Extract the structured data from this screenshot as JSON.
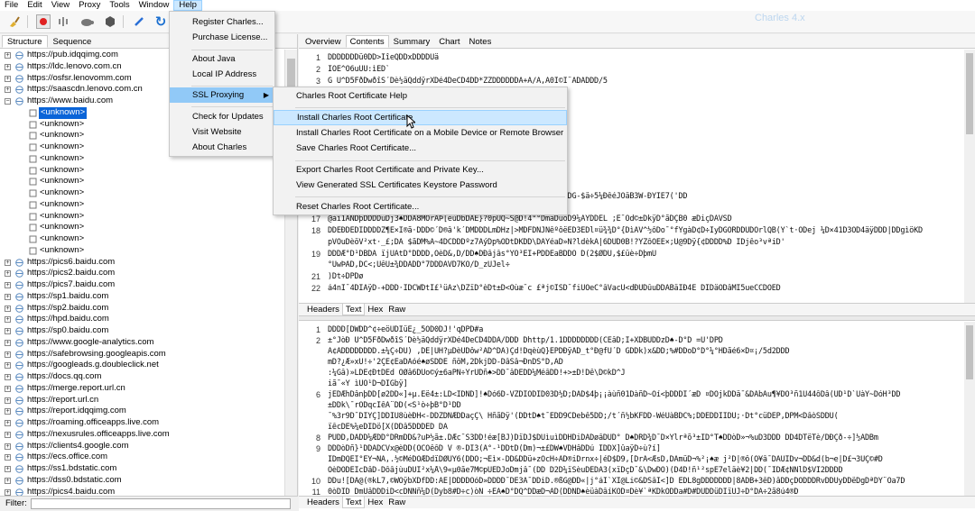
{
  "menubar": [
    "File",
    "Edit",
    "View",
    "Proxy",
    "Tools",
    "Window",
    "Help"
  ],
  "title_faint": "Charles 4.x",
  "toolbar": [
    {
      "name": "broom-icon",
      "glyph": "🧹",
      "color": "#d4a020"
    },
    {
      "name": "record-icon",
      "glyph": "●",
      "color": "#e02020"
    },
    {
      "name": "throttle-icon",
      "glyph": "⋮",
      "color": "#888"
    },
    {
      "name": "turtle-icon",
      "glyph": "🐢",
      "color": "#666"
    },
    {
      "name": "breakpoint-icon",
      "glyph": "⬢",
      "color": "#555"
    },
    {
      "name": "pen-icon",
      "glyph": "✎",
      "color": "#2a6fd6"
    },
    {
      "name": "refresh-icon",
      "glyph": "↻",
      "color": "#1a6fd0"
    }
  ],
  "left_tabs": [
    "Structure",
    "Sequence"
  ],
  "tree": [
    {
      "label": "https://pub.idqqimg.com",
      "child": false,
      "exp": "+"
    },
    {
      "label": "https://ldc.lenovo.com.cn",
      "child": false,
      "exp": "+"
    },
    {
      "label": "https://osfsr.lenovomm.com",
      "child": false,
      "exp": "+"
    },
    {
      "label": "https://saascdn.lenovo.com.cn",
      "child": false,
      "exp": "+"
    },
    {
      "label": "https://www.baidu.com",
      "child": false,
      "exp": "−"
    },
    {
      "label": "<unknown>",
      "child": true,
      "sel": true
    },
    {
      "label": "<unknown>",
      "child": true
    },
    {
      "label": "<unknown>",
      "child": true
    },
    {
      "label": "<unknown>",
      "child": true
    },
    {
      "label": "<unknown>",
      "child": true
    },
    {
      "label": "<unknown>",
      "child": true
    },
    {
      "label": "<unknown>",
      "child": true
    },
    {
      "label": "<unknown>",
      "child": true
    },
    {
      "label": "<unknown>",
      "child": true
    },
    {
      "label": "<unknown>",
      "child": true
    },
    {
      "label": "<unknown>",
      "child": true
    },
    {
      "label": "<unknown>",
      "child": true
    },
    {
      "label": "<unknown>",
      "child": true
    },
    {
      "label": "https://pics6.baidu.com",
      "child": false,
      "exp": "+"
    },
    {
      "label": "https://pics2.baidu.com",
      "child": false,
      "exp": "+"
    },
    {
      "label": "https://pics7.baidu.com",
      "child": false,
      "exp": "+"
    },
    {
      "label": "https://sp1.baidu.com",
      "child": false,
      "exp": "+"
    },
    {
      "label": "https://sp2.baidu.com",
      "child": false,
      "exp": "+"
    },
    {
      "label": "https://hpd.baidu.com",
      "child": false,
      "exp": "+"
    },
    {
      "label": "https://sp0.baidu.com",
      "child": false,
      "exp": "+"
    },
    {
      "label": "https://www.google-analytics.com",
      "child": false,
      "exp": "+"
    },
    {
      "label": "https://safebrowsing.googleapis.com",
      "child": false,
      "exp": "+"
    },
    {
      "label": "https://googleads.g.doubleclick.net",
      "child": false,
      "exp": "+"
    },
    {
      "label": "https://docs.qq.com",
      "child": false,
      "exp": "+"
    },
    {
      "label": "https://merge.report.url.cn",
      "child": false,
      "exp": "+"
    },
    {
      "label": "https://report.url.cn",
      "child": false,
      "exp": "+"
    },
    {
      "label": "https://report.idqqimg.com",
      "child": false,
      "exp": "+"
    },
    {
      "label": "https://roaming.officeapps.live.com",
      "child": false,
      "exp": "+"
    },
    {
      "label": "https://nexusrules.officeapps.live.com",
      "child": false,
      "exp": "+"
    },
    {
      "label": "https://clients4.google.com",
      "child": false,
      "exp": "+"
    },
    {
      "label": "https://ecs.office.com",
      "child": false,
      "exp": "+"
    },
    {
      "label": "https://ss1.bdstatic.com",
      "child": false,
      "exp": "+"
    },
    {
      "label": "https://dss0.bdstatic.com",
      "child": false,
      "exp": "+"
    },
    {
      "label": "https://pics4.baidu.com",
      "child": false,
      "exp": "+"
    }
  ],
  "filter_label": "Filter:",
  "right_tabs": [
    "Overview",
    "Contents",
    "Summary",
    "Chart",
    "Notes"
  ],
  "upper_lines": [
    {
      "n": "1",
      "t": "DDDDDDDü0DD>ÎîeQDDxDDDDÜä"
    },
    {
      "n": "2",
      "t": "ÎÔÊ^Ò6uÜÜ:ìÈD`"
    },
    {
      "n": "3",
      "t": "                G Ù^D5FðDwðîS´Dè½äQddÿrXDé4DeCD4DD*ZZDDDDDDÀ+À/À,À0Ì©Ì¨ÀDÀDDD/5"
    },
    {
      "n": "",
      "t": ""
    },
    {
      "n": "",
      "t": ""
    },
    {
      "n": "",
      "t": "                                                                          WrÚ1ì:RçâÃD4DázÆP¼Dègë0ðo  zanrDñD<^A.wqD° )ÜºHñ%¿$Döe"
    },
    {
      "n": "",
      "t": ""
    },
    {
      "n": "",
      "t": ""
    },
    {
      "n": "",
      "t": ""
    },
    {
      "n": "",
      "t": ""
    },
    {
      "n": "",
      "t": ""
    },
    {
      "n": "",
      "t": ""
    },
    {
      "n": "",
      "t": "                                                                          ÆIÙVDÒDÜDDDDDDDD4D#;.àaDDD5GQ½¿Lÿùò2÷ÐnìKbVXzS#~&0°üÐèDG-$ä÷5¼ÐêéJÔäB3W-ÐŸIE7('DD"
    },
    {
      "n": "",
      "t": "DjâÑDDûâ½ÆD−DDùôXDÞGDPsDÜDDDdD~R.♠♠Ü^±¦D×D£Dÿ"
    },
    {
      "n": "17",
      "t": "@àî1ÄNDþDDDDuDj3♠DDÂ8MOrÂÞ[èùDbDÂÊ}?0pÙQ~S@D!4°°DmãDüõD9¼ÄŸDDÊL ;È¯Öd©±DkÿD°ãDÇB0 æDiçDÂVSD"
    },
    {
      "n": "18",
      "t": "DDEÐDEDIDDDDŽ¶E×Í®ã·DDD©´D®â'k´DMDDDLmDHz|>MDFDÑJNêºôëÈD3ËDl¤ü¾¾D°{DìÃV^½ôDo¯°fYgàD¢D÷ÍyDGÓRDDUDÒrlQB(Ý`t·ÔDej ¼D×41D3ÒD4äÿDDD|DDgìöKD"
    },
    {
      "n": "",
      "t": "pVÖuDèöV²xt·_£;DÄ $ãDM%Â~4DCDDDºz7ÃýDp%ÔDtDKDD\\DÄÝéaD»Ñ?ldèkÂ|6DÜD0B!?YZôÖÈË×;U@9Dÿ{¢DDDD%D ÍDjêo³vªiD'"
    },
    {
      "n": "19",
      "t": "DDDÆ°D¹DBDÂ                ïjÜÀtD°DDDD,ÖèD&,D/DD♠DÐâjâs°YÖ³ÊÍ+PDDÊaBDDÕ D(2$ØDÜ,$£üè÷DþmÜ"
    },
    {
      "n": "",
      "t": "°ÜwÞÀD,DC<;ÙêÜ±¾DDÄDD°7DDDAVD7KÖ/D_zUJel÷"
    },
    {
      "n": "21",
      "t": ")Dt÷DPDø"
    },
    {
      "n": "22",
      "t": "á4nI¯4DÌÀÿD-+DDD·ÏDCWDtÏ£¹üÄz\\DZïD°èDt±D<Öùæ¯c           £ªj©ÎSD¯fiÜÖeC°âVacÙ<dÐÜDûuDDÂBäIÐ4É DÏDäÕDâMÏ5ueCCDÒÊD"
    }
  ],
  "mid_tabs": [
    "Headers",
    "Text",
    "Hex",
    "Raw"
  ],
  "lower_lines": [
    {
      "n": "1",
      "t": "DDDD[DWDD^¢÷eöÜDÏüÈ¿_5ÖD0DJ!'qDPD#a"
    },
    {
      "n": "2",
      "t": "±°JòÐ Ù^D5FðDwðîS´Dè½äQddÿrXDé4DeCD4DDÀ/DDD          Dhttp/1.1DDDDDDDD(CÈâD;Î+XDBUDDzD♠-D°D =Ú'DPD"
    },
    {
      "n": "",
      "t": "À¢ÀDDDDDDDD.±¼Ç÷DÙ) ,DÈ|ÙH?μDèÜDôw²ÂD^DÂ)Çd!DqèùQ}ÈPDÐÿÄD_t°Ð@fÜ´D GDDk)x&DD;%#DDoD°D°¼°HDãé6×D¤¡/5d2DDD"
    },
    {
      "n": "",
      "t": "mD?¿Æ»xÜ!÷'2ÇÊ¢ÈaDÂóé♠øSDDÈ ñöM,2DkjDD-DâSâ¬ÐnDS°D,ÄD"
    },
    {
      "n": "",
      "t": ":¼Gâ)»LDÊ¢ÐtDÈd ÒØâ6DUo©ý±6aPN÷ŸrÜDñ♠>DD¯âDÊDD¼MéâDD!+>±D!Dê\\D©kD^J"
    },
    {
      "n": "",
      "t": "iã¯«Y ìÚÔ¹D¬DÎGbÿ]"
    },
    {
      "n": "6",
      "t": "jÈDÆhDânþDD[ø2DD«]+µ.Èë4±:LD<IDÑD]!♠Dó6D-VZDÏÔDÎD03D½D;DÂD$4þ¡¡àùñ01DàñD~Öí<þDDDÍ´æD         ¤DÔjkDDä¯&DÂbÃu¶¥DÕ³ñ1Ü44ôDâ(ÙD¹D`ÜàY~DóH³DD"
    },
    {
      "n": "",
      "t": "±DDk\\¯rODqcIêÂ¨DD(<S¹ò÷þB°D¹DD"
    },
    {
      "n": "",
      "t": "¯%3r9D¯DIŸÇ]DDÎÙ8ùèÐH<-DDZDNÆDDaçÇ\\ HñãDÿ'(DDtD♠t¯ÈDD9CDebê5DD;/t´ñ½bKFDD-WéÚàBDC%;DDÉDDÎIDÜ;·Dt°cüDEP,DPM<DâòSDDÜ("
    },
    {
      "n": "",
      "t": "ïêcDÈ%¼eDIDö[X(DDâ5DDDÊD DÃ"
    },
    {
      "n": "8",
      "t": "PÜDD,DÁDD¼ÆDD°DRmDD&?uÞ½ã±.DÆc¯S3DD!éæ[BJ)DïDJ$DUìuìDDHDiDÂDøâDÜD°   D♠DRD¾D¯D×Ylrªõ³±ID°T♠DDòD»¬%uD3DDD DD4DTëTè/DÐÇð-÷]½ÄDBm"
    },
    {
      "n": "9",
      "t": "DDDòDñ}¹DDÂDCVx@èDD(ÔCÓêôD V           ®-DI3(À°-¹DDtD(Dm)¬±£DW♠VDHâDDú ÏDDX]ûaÿD÷ù?í]"
    },
    {
      "n": "",
      "t": "ÏDmDQÉÎ°EY¬NÂ,.½©MéDÒÆDdïDØUÝ6(DDO;¬Èì×-DD&DDü+zÖcH÷ÄD®iDrnx÷|éD$D9,[DrÁ<ÆsD,DÁmüD¬%²¡♠æ j²D|®ô(Ó¥â¯DÂÜÎDv¬DD&d(b¬e|D£¬3ÙÇ©#D"
    },
    {
      "n": "",
      "t": "ÖèDÔDÈÌcDâD-DôâjùuDÜÍ²x¼Å\\9«µ0ãe7M©pUÈDJoDmjâ¯(DD      D2D¼ïSèuDÊDÂ3(xïDçD¯&\\DwDÖ)(D4D!ñ¹²spÈ7eläè¥2|DD(¯ÎDÆ¢ÑNlD$VÌ2DDDD"
    },
    {
      "n": "10",
      "t": "DDu![DÂ@(®kL7,©WÕÿbXDfDD:ÀÈ|DDDDÒóD»DDDD¯DÈ3Â¯DDiD.®ßG@DD«|j°áÌ`XÌ@Li©&DSâÏ<]D EDL8gDDDDDDD|8ÂDB+3êD)âDDçDÕDDDRvDDÜyDDëDgDªDY¨Oa7D"
    },
    {
      "n": "11",
      "t": "0òDÎD DmUâDDDiD<cDNNñ¼D(Dyb8#D÷c)òN ÷EA♠D°DQ^DDæD¬ÄD(DDÑD♠èüàDâíKÓD¤Dè¥`ªKDkÓDDa#D#DUDDüDÍïÛJ÷D°DÂ÷2ã8ú4®D"
    }
  ],
  "bottom_tabs": [
    "Headers",
    "Text",
    "Hex",
    "Raw"
  ],
  "help_menu": [
    {
      "label": "Register Charles..."
    },
    {
      "label": "Purchase License..."
    },
    {
      "label": "About Java"
    },
    {
      "label": "Local IP Address"
    },
    {
      "label": "SSL Proxying",
      "submenu": true
    },
    {
      "label": "Check for Updates"
    },
    {
      "label": "Visit Website"
    },
    {
      "label": "About Charles"
    }
  ],
  "ssl_menu": [
    {
      "label": "Charles Root Certificate Help"
    },
    {
      "label": "Install Charles Root Certificate"
    },
    {
      "label": "Install Charles Root Certificate on a Mobile Device or Remote Browser"
    },
    {
      "label": "Save Charles Root Certificate..."
    },
    {
      "label": "Export Charles Root Certificate and Private Key..."
    },
    {
      "label": "View Generated SSL Certificates Keystore Password"
    },
    {
      "label": "Reset Charles Root Certificate..."
    }
  ]
}
